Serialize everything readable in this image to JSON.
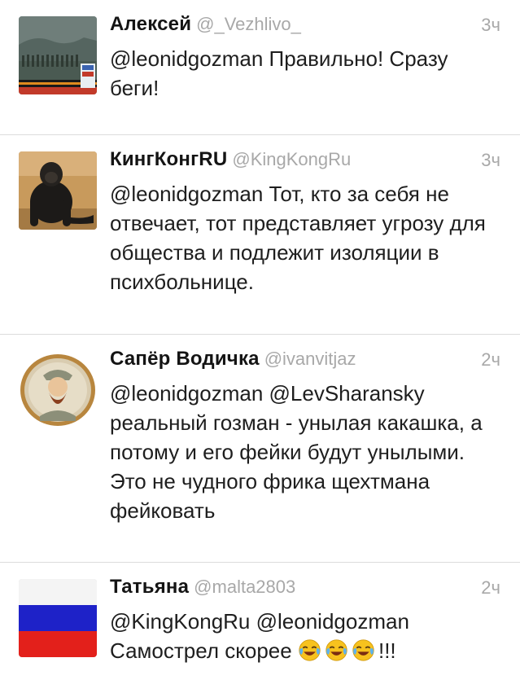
{
  "tweets": [
    {
      "name": "Алексей",
      "handle": "@_Vezhlivo_",
      "time": "3ч",
      "text": "@leonidgozman Правильно! Сразу беги!"
    },
    {
      "name": "КингКонгRU",
      "handle": "@KingKongRu",
      "time": "3ч",
      "text": "@leonidgozman Тот, кто за себя не отвечает, тот представляет угрозу для общества и подлежит изоляции в психбольнице."
    },
    {
      "name": "Сапёр Водичка",
      "handle": "@ivanvitjaz",
      "time": "2ч",
      "text": "@leonidgozman @LevSharansky реальный гозман - унылая какашка, а потому и его фейки будут унылыми. Это не чудного фрика щехтмана фейковать"
    },
    {
      "name": "Татьяна",
      "handle": "@malta2803",
      "time": "2ч",
      "text_line1": "@KingKongRu @leonidgozman",
      "text_line2": "Самострел скорее",
      "text_suffix": "!!!",
      "emoji_icon": "face-with-tears-of-joy-icon"
    }
  ],
  "colors": {
    "handle_gray": "#a8a8a8",
    "divider": "#dcdcdc",
    "text": "#1e1e1e"
  }
}
